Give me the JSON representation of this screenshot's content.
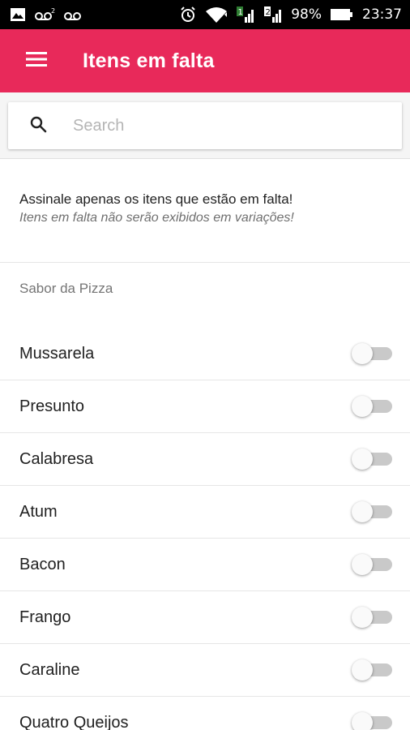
{
  "status_bar": {
    "battery": "98%",
    "time": "23:37",
    "left_icons": [
      "image-icon",
      "voicemail-icon",
      "voicemail-icon"
    ],
    "right_icons": [
      "alarm-icon",
      "wifi-icon",
      "signal-icon",
      "signal-icon",
      "battery-icon"
    ]
  },
  "app_bar": {
    "title": "Itens em falta",
    "menu_icon": "menu-icon",
    "color": "#e8295a"
  },
  "search": {
    "placeholder": "Search",
    "value": "",
    "icon": "search-icon"
  },
  "notice": {
    "line1": "Assinale apenas os itens que estão em falta!",
    "line2": "Itens em falta não serão exibidos em variações!"
  },
  "section": {
    "title": "Sabor da Pizza",
    "items": [
      {
        "label": "Mussarela",
        "missing": false
      },
      {
        "label": "Presunto",
        "missing": false
      },
      {
        "label": "Calabresa",
        "missing": false
      },
      {
        "label": "Atum",
        "missing": false
      },
      {
        "label": "Bacon",
        "missing": false
      },
      {
        "label": "Frango",
        "missing": false
      },
      {
        "label": "Caraline",
        "missing": false
      },
      {
        "label": "Quatro Queijos",
        "missing": false
      }
    ]
  }
}
